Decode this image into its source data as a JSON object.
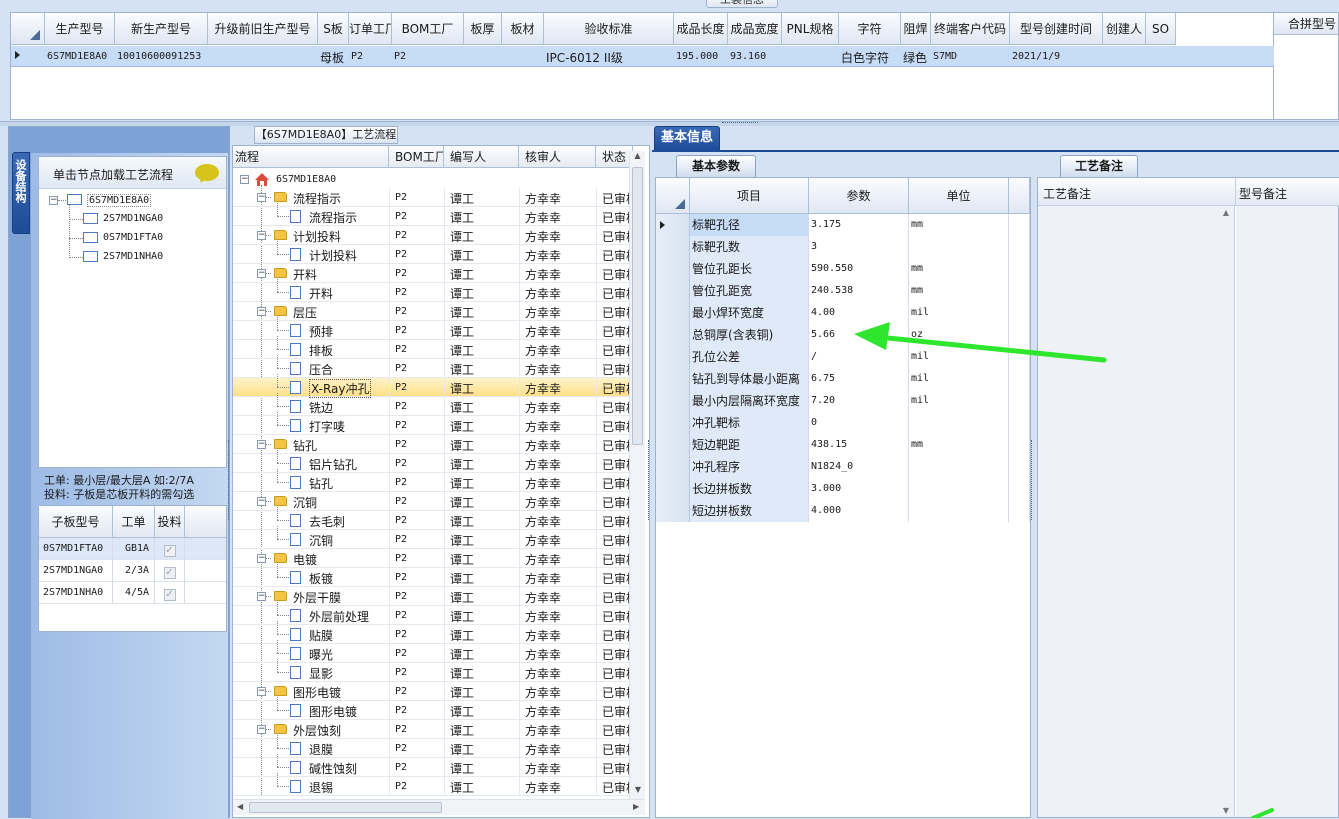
{
  "top_panel": {
    "caption": "工装信息",
    "columns": [
      "生产型号",
      "新生产型号",
      "升级前旧生产型号",
      "S板",
      "订单工厂",
      "BOM工厂",
      "板厚",
      "板材",
      "验收标准",
      "成品长度",
      "成品宽度",
      "PNL规格",
      "字符",
      "阻焊",
      "终端客户代码",
      "型号创建时间",
      "创建人",
      "SO"
    ],
    "row": [
      "6S7MD1E8A0",
      "10010600091253",
      "",
      "母板",
      "P2",
      "P2",
      "",
      "",
      "IPC-6012 II级",
      "195.000",
      "93.160",
      "",
      "白色字符",
      "绿色",
      "S7MD",
      "2021/1/9",
      "",
      ""
    ],
    "right_header": "合拼型号"
  },
  "left_panel": {
    "vertical_tab": "设备结构",
    "banner": "单击节点加载工艺流程",
    "tree_root": "6S7MD1E8A0",
    "tree_children": [
      "2S7MD1NGA0",
      "0S7MD1FTA0",
      "2S7MD1NHA0"
    ],
    "note_line1": "工单: 最小层/最大层A 如:2/7A",
    "note_line2": "投料: 子板是芯板开料的需勾选",
    "sub_table": {
      "headers": [
        "子板型号",
        "工单",
        "投料"
      ],
      "rows": [
        [
          "0S7MD1FTA0",
          "GB1A",
          "✓"
        ],
        [
          "2S7MD1NGA0",
          "2/3A",
          "✓"
        ],
        [
          "2S7MD1NHA0",
          "4/5A",
          "✓"
        ]
      ]
    }
  },
  "process_panel": {
    "title": "【6S7MD1E8A0】工艺流程",
    "headers": [
      "流程",
      "BOM工厂",
      "编写人",
      "核审人",
      "状态"
    ],
    "root": "6S7MD1E8A0",
    "rows": [
      {
        "name": "流程指示",
        "kind": "folder"
      },
      {
        "name": "流程指示",
        "kind": "doc"
      },
      {
        "name": "计划投料",
        "kind": "folder"
      },
      {
        "name": "计划投料",
        "kind": "doc"
      },
      {
        "name": "开料",
        "kind": "folder"
      },
      {
        "name": "开料",
        "kind": "doc"
      },
      {
        "name": "层压",
        "kind": "folder"
      },
      {
        "name": "预排",
        "kind": "doc"
      },
      {
        "name": "排板",
        "kind": "doc"
      },
      {
        "name": "压合",
        "kind": "doc"
      },
      {
        "name": "X-Ray冲孔",
        "kind": "doc",
        "selected": true
      },
      {
        "name": "铣边",
        "kind": "doc"
      },
      {
        "name": "打字唛",
        "kind": "doc"
      },
      {
        "name": "钻孔",
        "kind": "folder"
      },
      {
        "name": "铝片钻孔",
        "kind": "doc"
      },
      {
        "name": "钻孔",
        "kind": "doc"
      },
      {
        "name": "沉铜",
        "kind": "folder"
      },
      {
        "name": "去毛刺",
        "kind": "doc"
      },
      {
        "name": "沉铜",
        "kind": "doc"
      },
      {
        "name": "电镀",
        "kind": "folder"
      },
      {
        "name": "板镀",
        "kind": "doc"
      },
      {
        "name": "外层干膜",
        "kind": "folder"
      },
      {
        "name": "外层前处理",
        "kind": "doc"
      },
      {
        "name": "贴膜",
        "kind": "doc"
      },
      {
        "name": "曝光",
        "kind": "doc"
      },
      {
        "name": "显影",
        "kind": "doc"
      },
      {
        "name": "图形电镀",
        "kind": "folder"
      },
      {
        "name": "图形电镀",
        "kind": "doc"
      },
      {
        "name": "外层蚀刻",
        "kind": "folder"
      },
      {
        "name": "退膜",
        "kind": "doc"
      },
      {
        "name": "碱性蚀刻",
        "kind": "doc"
      },
      {
        "name": "退锡",
        "kind": "doc"
      }
    ],
    "bom": "P2",
    "writer": "谭工",
    "reviewer": "方幸幸",
    "status": "已审核"
  },
  "basic_info": {
    "tab": "基本信息",
    "subtab": "基本参数",
    "headers": [
      "项目",
      "参数",
      "单位"
    ],
    "rows": [
      [
        "标靶孔径",
        "3.175",
        "mm"
      ],
      [
        "标靶孔数",
        "3",
        ""
      ],
      [
        "管位孔距长",
        "590.550",
        "mm"
      ],
      [
        "管位孔距宽",
        "240.538",
        "mm"
      ],
      [
        "最小焊环宽度",
        "4.00",
        "mil"
      ],
      [
        "总铜厚(含表铜)",
        "5.66",
        "oz"
      ],
      [
        "孔位公差",
        "/",
        "mil"
      ],
      [
        "钻孔到导体最小距离",
        "6.75",
        "mil"
      ],
      [
        "最小内层隔离环宽度",
        "7.20",
        "mil"
      ],
      [
        "冲孔靶标",
        "0",
        ""
      ],
      [
        "短边靶距",
        "438.15",
        "mm"
      ],
      [
        "冲孔程序",
        "N1824_0",
        ""
      ],
      [
        "长边拼板数",
        "3.000",
        ""
      ],
      [
        "短边拼板数",
        "4.000",
        ""
      ]
    ]
  },
  "remarks": {
    "tab": "工艺备注",
    "col1": "工艺备注",
    "col2": "型号备注"
  },
  "colors": {
    "accent_blue": "#1e4c98",
    "selection": "#ffe7a0",
    "arrow": "#2ee62e"
  }
}
